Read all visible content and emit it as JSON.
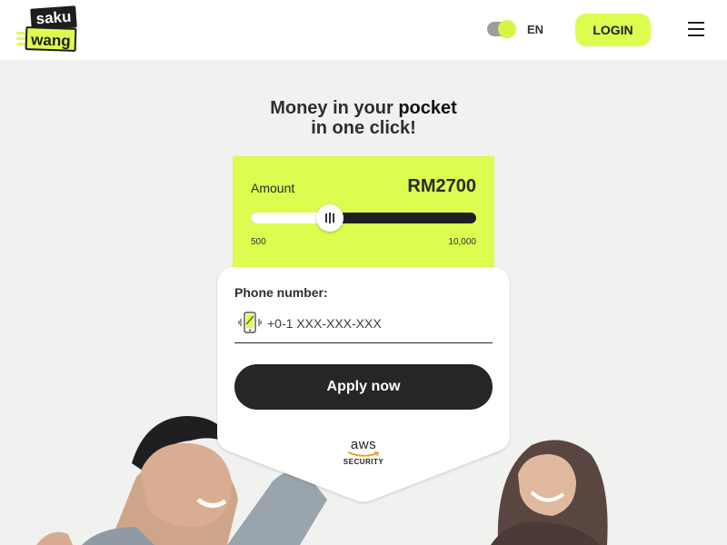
{
  "header": {
    "logo_top": "saku",
    "logo_bottom": "wang",
    "language": "EN",
    "login_label": "LOGIN"
  },
  "headline": {
    "part1": "Money in your ",
    "emphasis": "pocket",
    "line2": "in one click!"
  },
  "amount": {
    "label": "Amount",
    "value_text": "RM2700",
    "value": 2700,
    "min": 500,
    "max": 10000,
    "min_label": "500",
    "max_label": "10,000"
  },
  "form": {
    "phone_label": "Phone number:",
    "phone_placeholder": "+0-1 XXX-XXX-XXX",
    "apply_label": "Apply now"
  },
  "badge": {
    "word": "aws",
    "caption": "SECURITY"
  },
  "colors": {
    "accent": "#dcfc4f",
    "dark": "#262626",
    "background": "#f1f1ef"
  },
  "icons": [
    "menu-icon",
    "phone-icon",
    "aws-logo"
  ]
}
